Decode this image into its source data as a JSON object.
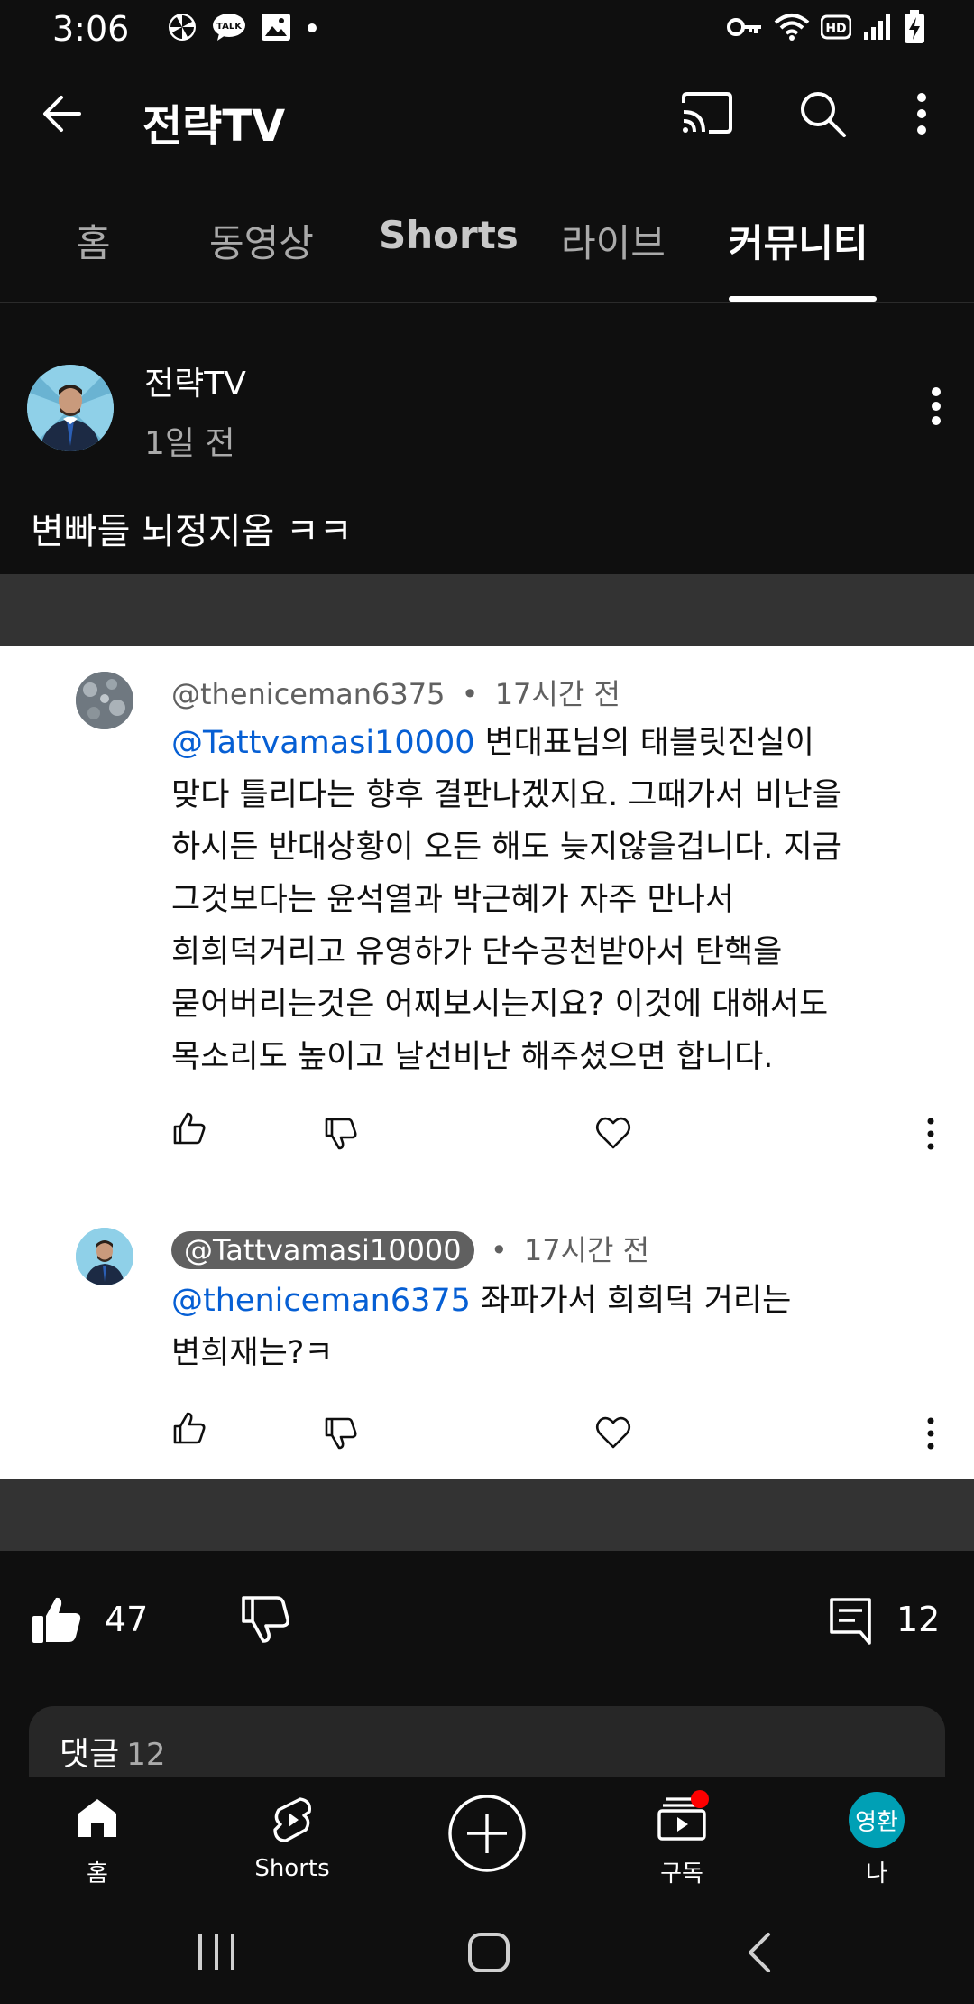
{
  "status_bar": {
    "time": "3:06",
    "left_icons": [
      "pinwheel-icon",
      "talk-icon",
      "gallery-icon",
      "dot-icon"
    ],
    "right_icons": [
      "key-icon",
      "wifi-icon",
      "hd-icon",
      "signal-icon",
      "battery-charging-icon"
    ],
    "talk_badge": "TALK",
    "hd_badge": "HD"
  },
  "app_bar": {
    "title": "전략TV",
    "icons": [
      "back-arrow-icon",
      "cast-icon",
      "search-icon",
      "more-vert-icon"
    ]
  },
  "tabs": [
    {
      "label": "홈",
      "active": false
    },
    {
      "label": "동영상",
      "active": false
    },
    {
      "label": "Shorts",
      "active": false
    },
    {
      "label": "라이브",
      "active": false
    },
    {
      "label": "커뮤니티",
      "active": true
    }
  ],
  "post": {
    "author": "전략TV",
    "time": "1일 전",
    "text": "변빠들 뇌정지옴 ㅋㅋ",
    "likes": "47",
    "comments": "12"
  },
  "comments": [
    {
      "handle": "@theniceman6375",
      "time_sep": "•",
      "time": "17시간 전",
      "mention": "@Tattvamasi10000",
      "text_first": " 변대표님의 태블릿진실이",
      "text_lines": [
        "맞다 틀리다는 향후 결판나겠지요. 그때가서 비난을",
        "하시든 반대상황이 오든 해도 늦지않을겁니다. 지금",
        "그것보다는 윤석열과 박근혜가 자주 만나서",
        "희희덕거리고 유영하가 단수공천받아서 탄핵을",
        "묻어버리는것은 어찌보시는지요? 이것에 대해서도",
        "목소리도 높이고 날선비난 해주셨으면 합니다."
      ]
    },
    {
      "handle": "@Tattvamasi10000",
      "time_sep": "•",
      "time": "17시간 전",
      "mention": "@theniceman6375",
      "text_first": " 좌파가서 희희덕 거리는",
      "text_lines": [
        "변희재는?ㅋ"
      ]
    }
  ],
  "comments_section": {
    "label": "댓글",
    "count": "12"
  },
  "bottom_nav": {
    "home": "홈",
    "shorts": "Shorts",
    "subscriptions": "구독",
    "me": "나",
    "me_avatar_text": "영환"
  },
  "colors": {
    "background": "#0f0f0f",
    "mention": "#065fd4",
    "me_avatar": "#00a0b5",
    "notification_dot": "#ff0000"
  }
}
